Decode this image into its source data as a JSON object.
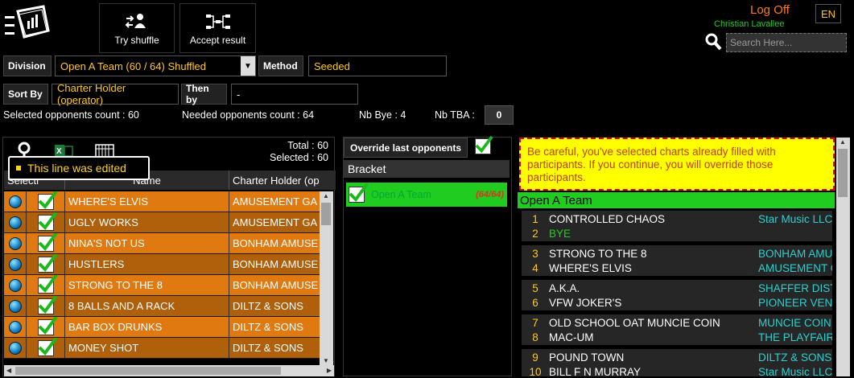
{
  "toolbar": {
    "menu_icon": "hamburger-logo-icon",
    "try_shuffle": "Try shuffle",
    "accept_result": "Accept result"
  },
  "user": {
    "logoff": "Log Off",
    "name": "Christian Lavallee",
    "lang": "EN",
    "search_placeholder": "Search Here..."
  },
  "filters": {
    "division_label": "Division",
    "division_value": "Open A Team (60 / 64) Shuffled",
    "method_label": "Method",
    "method_value": "Seeded",
    "sortby_label": "Sort By",
    "sortby_value": "Charter Holder (operator)",
    "thenby_label": "Then by",
    "thenby_value": "-"
  },
  "counts": {
    "selected": "Selected opponents count : 60",
    "needed": "Needed opponents count : 64",
    "bye": "Nb Bye : 4",
    "tba_label": "Nb TBA :",
    "tba_value": "0"
  },
  "left": {
    "total": "Total : 60",
    "selected": "Selected : 60",
    "tooltip": "This line was edited",
    "col_select": "Selecti",
    "col_name": "Name",
    "col_holder": "Charter Holder (op",
    "rows": [
      {
        "name": "WHERE'S ELVIS",
        "holder": "AMUSEMENT GA"
      },
      {
        "name": "UGLY WORKS",
        "holder": "AMUSEMENT GA"
      },
      {
        "name": "NINA'S NOT US",
        "holder": "BONHAM AMUSE"
      },
      {
        "name": "HUSTLERS",
        "holder": "BONHAM AMUSE"
      },
      {
        "name": "STRONG TO THE 8",
        "holder": "BONHAM AMUSE"
      },
      {
        "name": "8 BALLS AND A RACK",
        "holder": "DILTZ & SONS"
      },
      {
        "name": "BAR BOX DRUNKS",
        "holder": "DILTZ & SONS"
      },
      {
        "name": "MONEY SHOT",
        "holder": "DILTZ & SONS"
      }
    ]
  },
  "middle": {
    "override": "Override last opponents",
    "bracket_title": "Bracket",
    "bracket_name": "Open A Team",
    "bracket_count": "(64/64)"
  },
  "right": {
    "warning": "Be careful, you've selected charts already filled with participants. If you continue, you will override those participants.",
    "team_title": "Open A Team",
    "pairs": [
      [
        {
          "num": "1",
          "name": "CONTROLLED CHAOS",
          "owner": "Star Music LLC"
        },
        {
          "num": "2",
          "name": "BYE",
          "owner": "",
          "bye": true
        }
      ],
      [
        {
          "num": "3",
          "name": "STRONG TO THE 8",
          "owner": "BONHAM AMUSE"
        },
        {
          "num": "4",
          "name": "WHERE'S ELVIS",
          "owner": "AMUSEMENT GA"
        }
      ],
      [
        {
          "num": "5",
          "name": "A.K.A.",
          "owner": "SHAFFER DISTR"
        },
        {
          "num": "6",
          "name": "VFW JOKER'S",
          "owner": "PIONEER VENDI"
        }
      ],
      [
        {
          "num": "7",
          "name": "OLD SCHOOL OAT MUNCIE COIN",
          "owner": "MUNCIE COIN"
        },
        {
          "num": "8",
          "name": "MAC-UM",
          "owner": "THE PLAYFAIR"
        }
      ],
      [
        {
          "num": "9",
          "name": "POUND TOWN",
          "owner": "DILTZ & SONS"
        },
        {
          "num": "10",
          "name": "BILL F N MURRAY",
          "owner": "Star Music LLC"
        }
      ]
    ]
  },
  "colors": {
    "accent_orange": "#e07a10",
    "accent_green": "#1fcc1f",
    "accent_yellow": "#ffc81e",
    "warning_bg": "#ffff00"
  }
}
